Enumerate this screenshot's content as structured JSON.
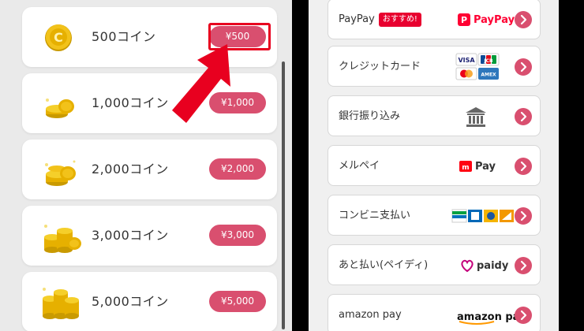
{
  "coin_options": [
    {
      "label": "500コイン",
      "price": "¥500",
      "icon": "single-coin-icon"
    },
    {
      "label": "1,000コイン",
      "price": "¥1,000",
      "icon": "coin-stack-small-icon"
    },
    {
      "label": "2,000コイン",
      "price": "¥2,000",
      "icon": "coin-stack-medium-icon"
    },
    {
      "label": "3,000コイン",
      "price": "¥3,000",
      "icon": "coin-stack-large-icon"
    },
    {
      "label": "5,000コイン",
      "price": "¥5,000",
      "icon": "coin-stack-xlarge-icon"
    }
  ],
  "payment_methods": [
    {
      "label": "PayPay",
      "badge": "おすすめ!",
      "logo_text": "PayPay",
      "logo_icon": "paypay-logo-icon"
    },
    {
      "label": "クレジットカード",
      "logo_icon": "credit-card-brands-icon",
      "brands": [
        "VISA",
        "JCB",
        "AMEX"
      ]
    },
    {
      "label": "銀行振り込み",
      "logo_icon": "bank-icon"
    },
    {
      "label": "メルペイ",
      "logo_text": "Pay",
      "logo_icon": "merpay-logo-icon"
    },
    {
      "label": "コンビニ支払い",
      "logo_icon": "convenience-store-logos-icon"
    },
    {
      "label": "あと払い(ペイディ)",
      "logo_text": "paidy",
      "logo_icon": "paidy-logo-icon"
    },
    {
      "label": "amazon pay",
      "logo_text": "amazon pay",
      "logo_icon": "amazon-pay-logo-icon"
    }
  ],
  "colors": {
    "accent": "#d94f6f",
    "highlight": "#e8001f",
    "coin_gold": "#e6b800"
  }
}
